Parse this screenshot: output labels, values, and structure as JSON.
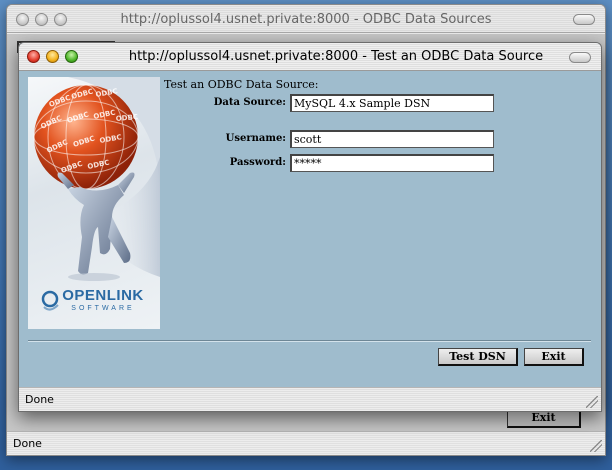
{
  "back_window": {
    "title": "http://oplussol4.usnet.private:8000 - ODBC Data Sources",
    "exit_label": "Exit",
    "status": "Done"
  },
  "front_window": {
    "title": "http://oplussol4.usnet.private:8000 - Test an ODBC Data Source",
    "status": "Done"
  },
  "brand": {
    "name": "OPENLINK",
    "tagline": "SOFTWARE",
    "sphere_text": "ODBC"
  },
  "form": {
    "heading": "Test an ODBC Data Source:",
    "data_source_label": "Data Source:",
    "data_source_value": "MySQL 4.x Sample DSN",
    "username_label": "Username:",
    "username_value": "scott",
    "password_label": "Password:",
    "password_value": "*****"
  },
  "buttons": {
    "test_dsn": "Test DSN",
    "exit": "Exit"
  },
  "colors": {
    "content_bg": "#9fbccd",
    "brand_blue": "#2a6aa3",
    "sphere_red": "#d9451c"
  }
}
